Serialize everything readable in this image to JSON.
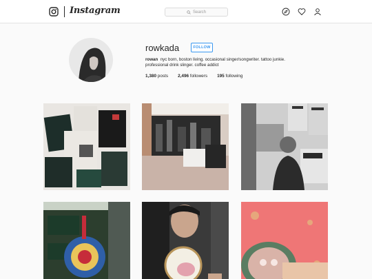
{
  "header": {
    "wordmark": "Instagram",
    "search_placeholder": "Search",
    "icons": [
      "instagram-glyph-icon",
      "compass-icon",
      "heart-icon",
      "person-icon"
    ]
  },
  "profile": {
    "username": "rowkada",
    "follow_label": "FOLLOW",
    "full_name": "rowan",
    "bio": "nyc born, boston living. occasional singer/songwriter. tattoo junkie. professional drink slinger. coffee addict",
    "posts_count": "1,380",
    "posts_label": "posts",
    "followers_count": "2,496",
    "followers_label": "followers",
    "following_count": "195",
    "following_label": "following"
  },
  "grid": {
    "posts": [
      {
        "subject": "band t-shirts laid out"
      },
      {
        "subject": "bedroom with city mural"
      },
      {
        "subject": "portrait in front of posters"
      },
      {
        "subject": "street sign and embroidered ornament"
      },
      {
        "subject": "man holding embroidery hoop"
      },
      {
        "subject": "coffee cup on pink table"
      }
    ]
  }
}
